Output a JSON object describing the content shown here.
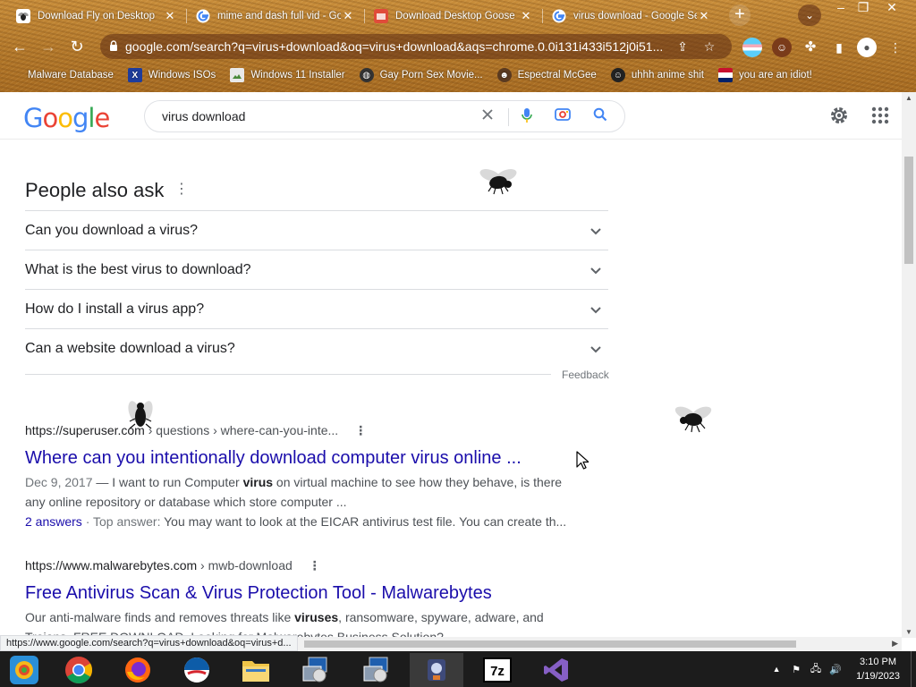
{
  "browser": {
    "tabs": [
      {
        "title": "Download Fly on Desktop",
        "favicon": "fly-favicon",
        "active": false
      },
      {
        "title": "mime and dash full vid - Go",
        "favicon": "google-favicon",
        "active": false
      },
      {
        "title": "Download Desktop Goose",
        "favicon": "goose-favicon",
        "active": false
      },
      {
        "title": "virus download - Google Se",
        "favicon": "google-favicon",
        "active": true
      }
    ],
    "url": "google.com/search?q=virus+download&oq=virus+download&aqs=chrome.0.0i131i433i512j0i51...",
    "bookmarks": [
      {
        "label": "Malware Database",
        "icon": "bookmark-icon"
      },
      {
        "label": "Windows ISOs",
        "icon": "x-logo-icon"
      },
      {
        "label": "Windows 11 Installer",
        "icon": "image-icon"
      },
      {
        "label": "Gay Porn Sex Movie...",
        "icon": "globe-icon"
      },
      {
        "label": "Espectral McGee",
        "icon": "mascot-icon"
      },
      {
        "label": "uhhh anime shit",
        "icon": "anime-icon"
      },
      {
        "label": "you are an idiot!",
        "icon": "flag-icon"
      }
    ]
  },
  "google": {
    "logo": "Google",
    "query": "virus download"
  },
  "paa": {
    "heading": "People also ask",
    "questions": [
      "Can you download a virus?",
      "What is the best virus to download?",
      "How do I install a virus app?",
      "Can a website download a virus?"
    ],
    "feedback": "Feedback"
  },
  "results": [
    {
      "site": "https://superuser.com",
      "path": " › questions › where-can-you-inte...",
      "title": "Where can you intentionally download computer virus online ...",
      "date": "Dec 9, 2017",
      "snippet_pre": " — I want to run Computer ",
      "snippet_bold": "virus",
      "snippet_post": " on virtual machine to see how they behave, is there any online repository or database which store computer ...",
      "answers": "2 answers",
      "top_answer_label": " · Top answer: ",
      "top_answer": "You may want to look at the EICAR antivirus test file. You can create th..."
    },
    {
      "site": "https://www.malwarebytes.com",
      "path": " › mwb-download",
      "title": "Free Antivirus Scan & Virus Protection Tool - Malwarebytes",
      "snippet_pre": "Our anti-malware finds and removes threats like ",
      "snippet_bold": "viruses",
      "snippet_post": ", ransomware, spyware, adware, and Trojans. FREE DOWNLOAD. Looking for Malwarebytes Business Solution?"
    }
  ],
  "status_url": "https://www.google.com/search?q=virus+download&oq=virus+d...",
  "taskbar": {
    "apps": [
      "start-icon",
      "chrome-icon",
      "firefox-icon",
      "obama-app-icon",
      "file-explorer-icon",
      "installer-icon",
      "installer-icon",
      "goose-app-icon",
      "7zip-icon",
      "visual-studio-icon"
    ],
    "time": "3:10 PM",
    "date": "1/19/2023"
  },
  "colors": {
    "link": "#1a0dab",
    "google_blue": "#4285f4",
    "google_red": "#ea4335",
    "google_yellow": "#fbbc05",
    "google_green": "#34a853",
    "chrome_theme": "#b57a2c"
  }
}
